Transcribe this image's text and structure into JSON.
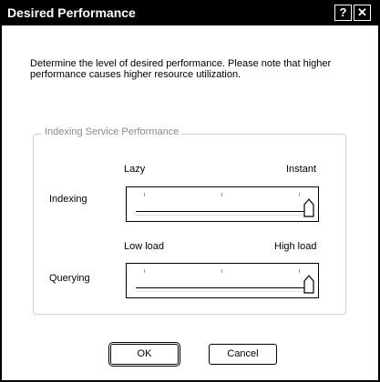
{
  "window": {
    "title": "Desired Performance",
    "help_glyph": "?",
    "close_glyph": "✕"
  },
  "description": "Determine the level of desired performance. Please note that higher performance causes higher resource utilization.",
  "group": {
    "legend": "Indexing Service Performance",
    "indexing": {
      "label": "Indexing",
      "min_label": "Lazy",
      "max_label": "Instant",
      "value_fraction": 1.0
    },
    "querying": {
      "label": "Querying",
      "min_label": "Low load",
      "max_label": "High load",
      "value_fraction": 1.0
    }
  },
  "buttons": {
    "ok": "OK",
    "cancel": "Cancel"
  },
  "colors": {
    "titlebar": "#000000",
    "group_border": "#cfcfcf",
    "group_legend": "#888888"
  },
  "icons": [
    "help-icon",
    "close-icon",
    "slider-thumb-icon"
  ]
}
